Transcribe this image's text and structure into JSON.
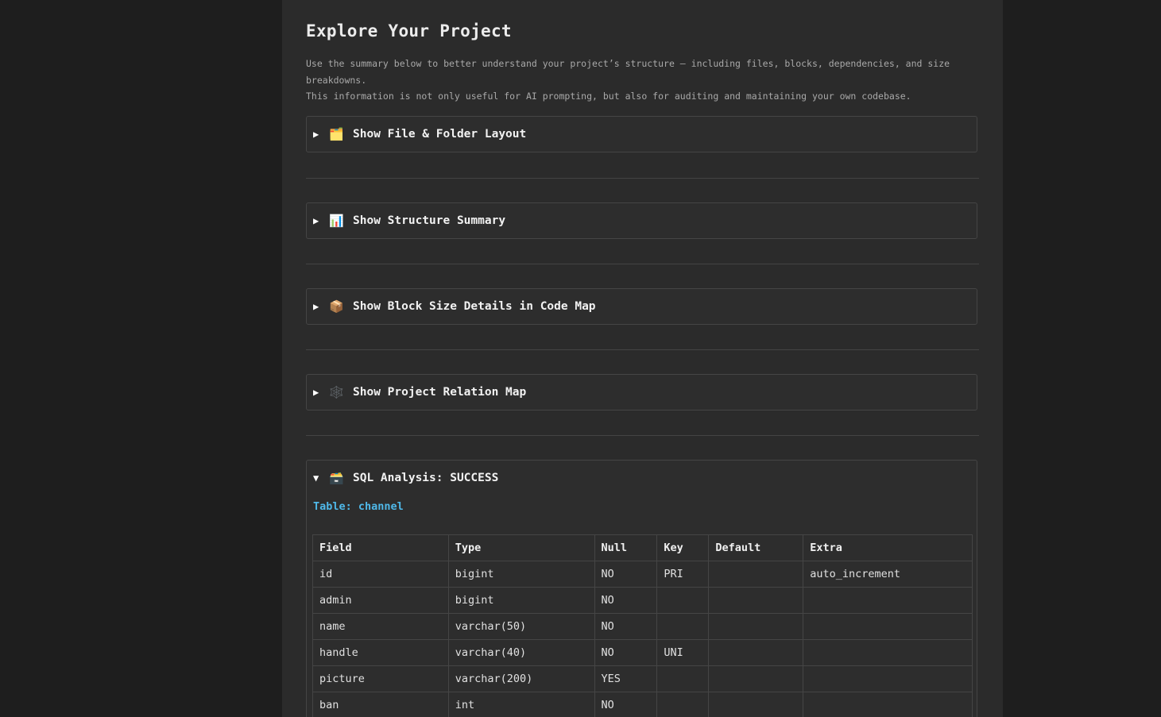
{
  "page": {
    "title": "Explore Your Project",
    "intro_line1": "Use the summary below to better understand your project’s structure — including files, blocks, dependencies, and size breakdowns.",
    "intro_line2": "This information is not only useful for AI prompting, but also for auditing and maintaining your own codebase."
  },
  "panels": [
    {
      "caret": "▶",
      "icon": "🗂️",
      "icon_name": "folder-icon",
      "label": "Show File & Folder Layout",
      "expanded": false
    },
    {
      "caret": "▶",
      "icon": "📊",
      "icon_name": "bar-chart-icon",
      "label": "Show Structure Summary",
      "expanded": false
    },
    {
      "caret": "▶",
      "icon": "📦",
      "icon_name": "package-icon",
      "label": "Show Block Size Details in Code Map",
      "expanded": false
    },
    {
      "caret": "▶",
      "icon": "🕸️",
      "icon_name": "relation-map-icon",
      "label": "Show Project Relation Map",
      "expanded": false
    },
    {
      "caret": "▼",
      "icon": "🗃️",
      "icon_name": "card-file-box-icon",
      "label": "SQL Analysis: SUCCESS",
      "expanded": true
    }
  ],
  "sql": {
    "table_label": "Table: channel",
    "columns": [
      "Field",
      "Type",
      "Null",
      "Key",
      "Default",
      "Extra"
    ],
    "rows": [
      [
        "id",
        "bigint",
        "NO",
        "PRI",
        "",
        "auto_increment"
      ],
      [
        "admin",
        "bigint",
        "NO",
        "",
        "",
        ""
      ],
      [
        "name",
        "varchar(50)",
        "NO",
        "",
        "",
        ""
      ],
      [
        "handle",
        "varchar(40)",
        "NO",
        "UNI",
        "",
        ""
      ],
      [
        "picture",
        "varchar(200)",
        "YES",
        "",
        "",
        ""
      ],
      [
        "ban",
        "int",
        "NO",
        "",
        "",
        ""
      ]
    ]
  },
  "colors": {
    "background": "#1e1e1e",
    "page": "#2b2b2b",
    "accent": "#4fb8e8"
  }
}
